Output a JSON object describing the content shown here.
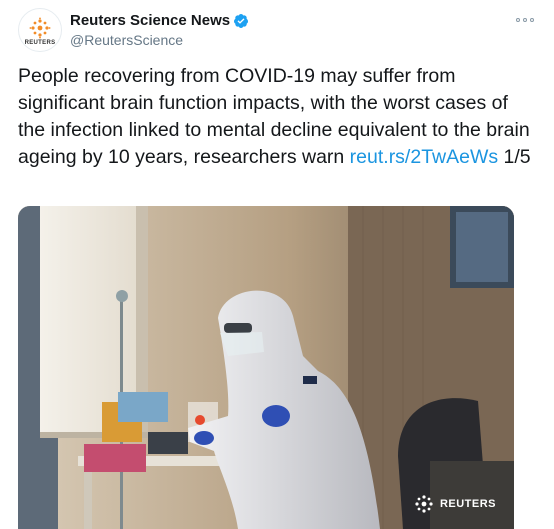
{
  "account": {
    "display_name": "Reuters Science News",
    "handle": "@ReutersScience",
    "avatar_word": "REUTERS",
    "verified": true
  },
  "tweet": {
    "text_before_link": "People recovering from COVID-19 may suffer from significant brain function impacts, with the worst cases of the infection linked to mental decline equivalent to the brain ageing by 10 years, researchers warn ",
    "link_text": "reut.rs/2TwAeWs",
    "text_after_link": " 1/5"
  },
  "media": {
    "watermark_text": "REUTERS"
  },
  "icons": {
    "more": "more-options-icon",
    "verified": "verified-badge-icon",
    "reuters_logo": "reuters-logo-icon"
  },
  "colors": {
    "link": "#1b95e0",
    "verified": "#1da1f2",
    "reuters_orange": "#f28c28",
    "text": "#14171a",
    "muted": "#657786"
  }
}
